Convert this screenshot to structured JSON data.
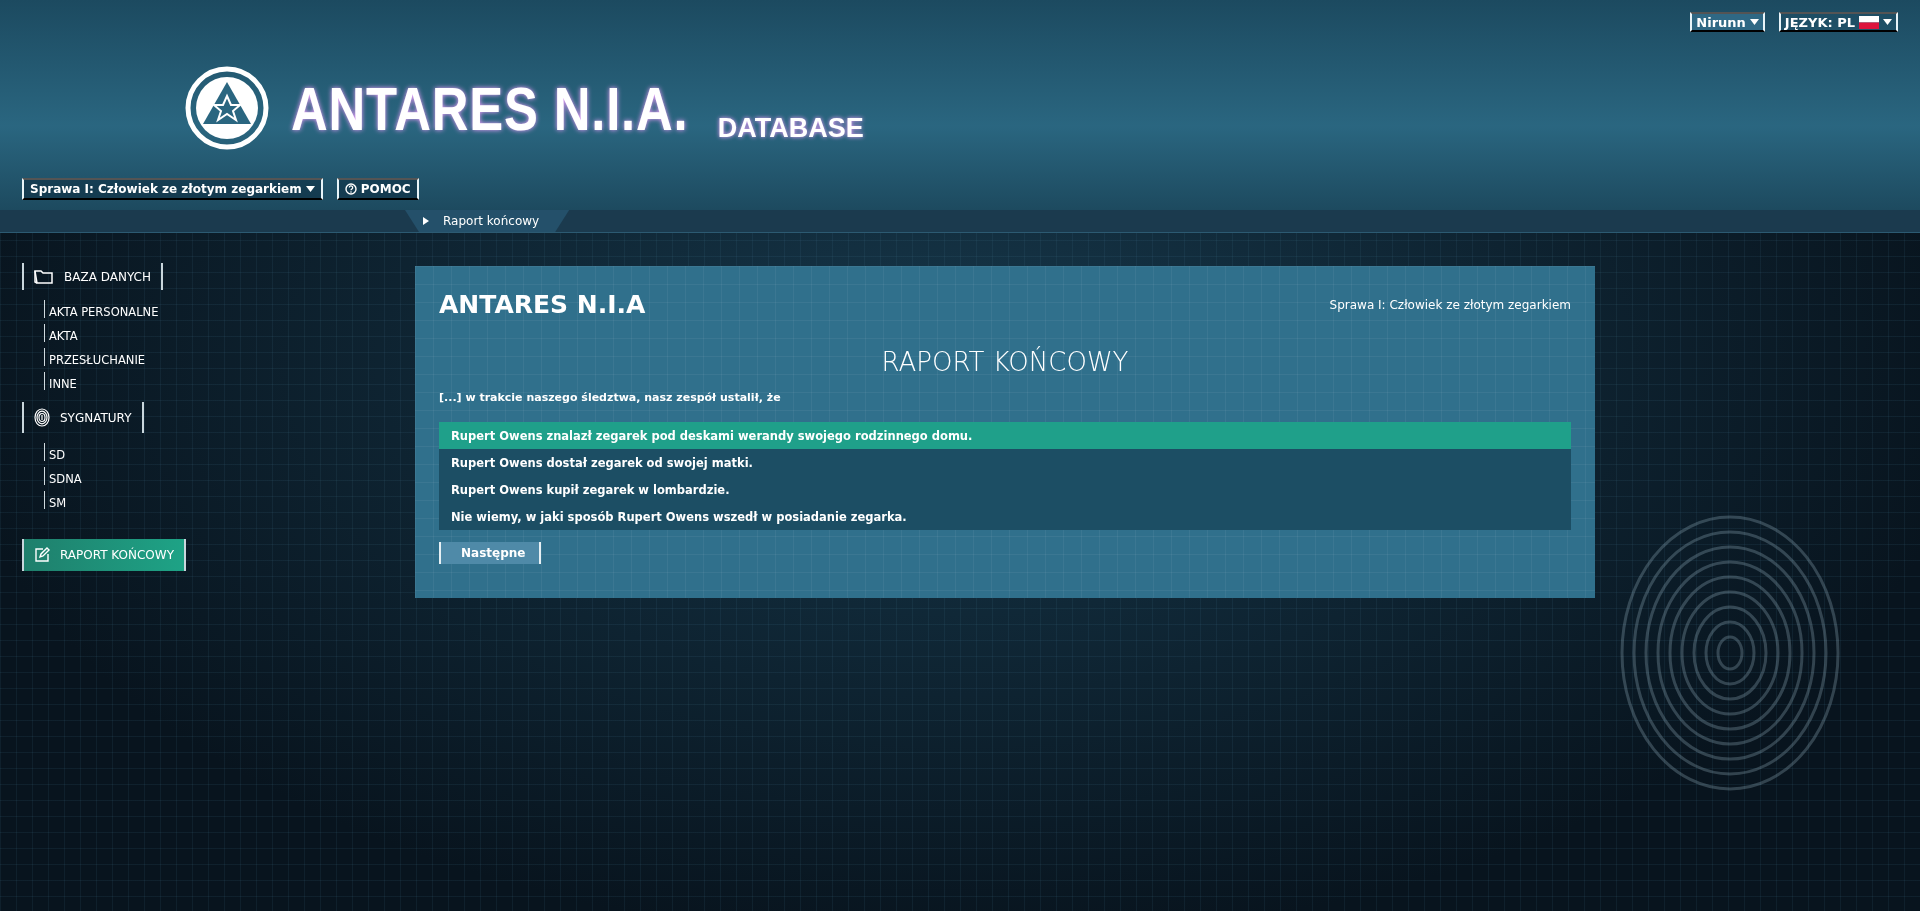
{
  "header": {
    "logo_title": "ANTARES N.I.A.",
    "logo_subtitle": "DATABASE",
    "user_menu": "Nirunn",
    "language": "JĘZYK: PL",
    "case_selector": "Sprawa I: Człowiek ze złotym zegarkiem",
    "help_button": "POMOC"
  },
  "breadcrumb": "Raport końcowy",
  "sidebar": {
    "sections": [
      {
        "label": "BAZA DANYCH",
        "kind": "folder",
        "selected": false,
        "children": [
          {
            "label": "AKTA PERSONALNE",
            "selected": false
          },
          {
            "label": "AKTA",
            "selected": false
          },
          {
            "label": "PRZESŁUCHANIE",
            "selected": false
          },
          {
            "label": "INNE",
            "selected": false
          }
        ]
      },
      {
        "label": "SYGNATURY",
        "kind": "fingerprint",
        "selected": false,
        "children": [
          {
            "label": "SD",
            "selected": false
          },
          {
            "label": "SDNA",
            "selected": false
          },
          {
            "label": "SM",
            "selected": false
          }
        ]
      },
      {
        "label": "RAPORT KOŃCOWY",
        "kind": "edit",
        "selected": true
      }
    ]
  },
  "panel": {
    "title": "ANTARES N.I.A",
    "case": "Sprawa I: Człowiek ze złotym zegarkiem",
    "heading": "RAPORT KOŃCOWY",
    "prompt": "[...] w trakcie naszego śledztwa, nasz zespół ustalił, że",
    "options": [
      {
        "text": "Rupert Owens znalazł zegarek pod deskami werandy swojego rodzinnego domu.",
        "selected": true
      },
      {
        "text": "Rupert Owens dostał zegarek od swojej matki.",
        "selected": false
      },
      {
        "text": "Rupert Owens kupił zegarek w lombardzie.",
        "selected": false
      },
      {
        "text": "Nie wiemy, w jaki sposób Rupert Owens wszedł w posiadanie zegarka.",
        "selected": false
      }
    ],
    "next_button": "Następne"
  }
}
